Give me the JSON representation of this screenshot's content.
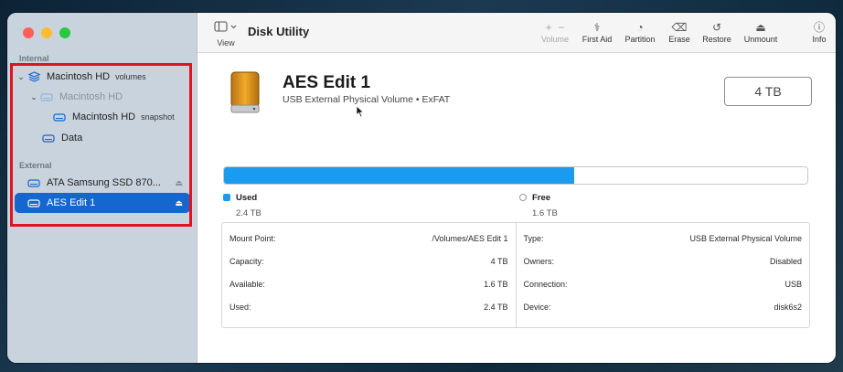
{
  "app": {
    "title": "Disk Utility"
  },
  "toolbar": {
    "view_label": "View",
    "volume_label": "Volume",
    "first_aid_label": "First Aid",
    "partition_label": "Partition",
    "erase_label": "Erase",
    "restore_label": "Restore",
    "unmount_label": "Unmount",
    "info_label": "Info",
    "add_glyph": "+",
    "remove_glyph": "−"
  },
  "sidebar": {
    "internal_label": "Internal",
    "external_label": "External",
    "items": [
      {
        "label": "Macintosh HD",
        "sub": "volumes"
      },
      {
        "label": "Macintosh HD",
        "sub": ""
      },
      {
        "label": "Macintosh HD",
        "sub": "snapshot"
      },
      {
        "label": "Data",
        "sub": ""
      },
      {
        "label": "ATA Samsung SSD 870...",
        "sub": ""
      },
      {
        "label": "AES Edit 1",
        "sub": ""
      }
    ]
  },
  "disk": {
    "name": "AES Edit 1",
    "description": "USB External Physical Volume • ExFAT",
    "capacity": "4 TB",
    "used_fraction": 0.6
  },
  "usage": {
    "used_label": "Used",
    "used_value": "2.4 TB",
    "free_label": "Free",
    "free_value": "1.6 TB"
  },
  "info_left": [
    {
      "key": "Mount Point:",
      "value": "/Volumes/AES Edit 1"
    },
    {
      "key": "Capacity:",
      "value": "4 TB"
    },
    {
      "key": "Available:",
      "value": "1.6 TB"
    },
    {
      "key": "Used:",
      "value": "2.4 TB"
    }
  ],
  "info_right": [
    {
      "key": "Type:",
      "value": "USB External Physical Volume"
    },
    {
      "key": "Owners:",
      "value": "Disabled"
    },
    {
      "key": "Connection:",
      "value": "USB"
    },
    {
      "key": "Device:",
      "value": "disk6s2"
    }
  ],
  "colors": {
    "accent": "#1666cf",
    "used": "#1a9bf0",
    "annotation": "#e0141e"
  }
}
